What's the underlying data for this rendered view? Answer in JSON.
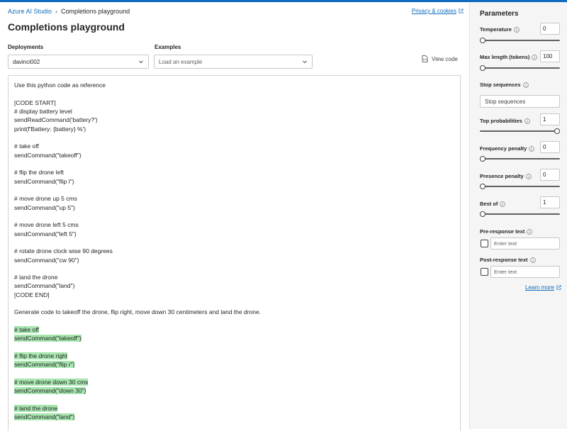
{
  "breadcrumb": {
    "root": "Azure AI Studio",
    "current": "Completions playground"
  },
  "privacy_link": "Privacy & cookies",
  "page_title": "Completions playground",
  "deployments": {
    "label": "Deployments",
    "value": "davinci002"
  },
  "examples": {
    "label": "Examples",
    "placeholder": "Load an example"
  },
  "view_code": "View code",
  "editor": {
    "lines": [
      {
        "text": "Use this python code as reference",
        "highlight": false
      },
      {
        "text": "",
        "highlight": false
      },
      {
        "text": "[CODE START]",
        "highlight": false
      },
      {
        "text": "# display battery level",
        "highlight": false
      },
      {
        "text": "sendReadCommand('battery?')",
        "highlight": false
      },
      {
        "text": "print(f'Battery: {battery} %')",
        "highlight": false
      },
      {
        "text": "",
        "highlight": false
      },
      {
        "text": "# take off",
        "highlight": false
      },
      {
        "text": "sendCommand(\"takeoff\")",
        "highlight": false
      },
      {
        "text": "",
        "highlight": false
      },
      {
        "text": "# flip the drone left",
        "highlight": false
      },
      {
        "text": "sendCommand(\"flip l\")",
        "highlight": false
      },
      {
        "text": "",
        "highlight": false
      },
      {
        "text": "# move drone up 5 cms",
        "highlight": false
      },
      {
        "text": "sendCommand(\"up 5\")",
        "highlight": false
      },
      {
        "text": "",
        "highlight": false
      },
      {
        "text": "# move drone left 5 cms",
        "highlight": false
      },
      {
        "text": "sendCommand(\"left 5\")",
        "highlight": false
      },
      {
        "text": "",
        "highlight": false
      },
      {
        "text": "# rotate drone clock wise 90 degrees",
        "highlight": false
      },
      {
        "text": "sendCommand(\"cw 90\")",
        "highlight": false
      },
      {
        "text": "",
        "highlight": false
      },
      {
        "text": "# land the drone",
        "highlight": false
      },
      {
        "text": "sendCommand(\"land\")",
        "highlight": false
      },
      {
        "text": "[CODE END]",
        "highlight": false
      },
      {
        "text": "",
        "highlight": false
      },
      {
        "text": "Generate code to takeoff the drone, flip right, move down 30 centimeters and land the drone.",
        "highlight": false
      },
      {
        "text": "",
        "highlight": false
      },
      {
        "text": "# take off",
        "highlight": true
      },
      {
        "text": "sendCommand(\"takeoff\")",
        "highlight": true
      },
      {
        "text": "",
        "highlight": false
      },
      {
        "text": "# flip the drone right",
        "highlight": true
      },
      {
        "text": "sendCommand(\"flip r\")",
        "highlight": true
      },
      {
        "text": "",
        "highlight": false
      },
      {
        "text": "# move drone down 30 cms",
        "highlight": true
      },
      {
        "text": "sendCommand(\"down 30\")",
        "highlight": true
      },
      {
        "text": "",
        "highlight": false
      },
      {
        "text": "# land the drone",
        "highlight": true
      },
      {
        "text": "sendCommand(\"land\")",
        "highlight": true
      }
    ]
  },
  "parameters": {
    "title": "Parameters",
    "temperature": {
      "label": "Temperature",
      "value": "0",
      "level": 0.0
    },
    "max_length": {
      "label": "Max length (tokens)",
      "value": "100",
      "level": 0.0
    },
    "stop_sequences": {
      "label": "Stop sequences",
      "placeholder": "Stop sequences"
    },
    "top_p": {
      "label": "Top probabilities",
      "value": "1",
      "level": 1.0
    },
    "frequency_penalty": {
      "label": "Frequency penalty",
      "value": "0",
      "level": 0.0
    },
    "presence_penalty": {
      "label": "Presence penalty",
      "value": "0",
      "level": 0.0
    },
    "best_of": {
      "label": "Best of",
      "value": "1",
      "level": 0.0
    },
    "pre_response": {
      "label": "Pre-response text",
      "placeholder": "Enter text"
    },
    "post_response": {
      "label": "Post-response text",
      "placeholder": "Enter text"
    },
    "learn_more": "Learn more"
  },
  "colors": {
    "accent": "#0f6cbd",
    "highlight": "#a8e6b0"
  }
}
